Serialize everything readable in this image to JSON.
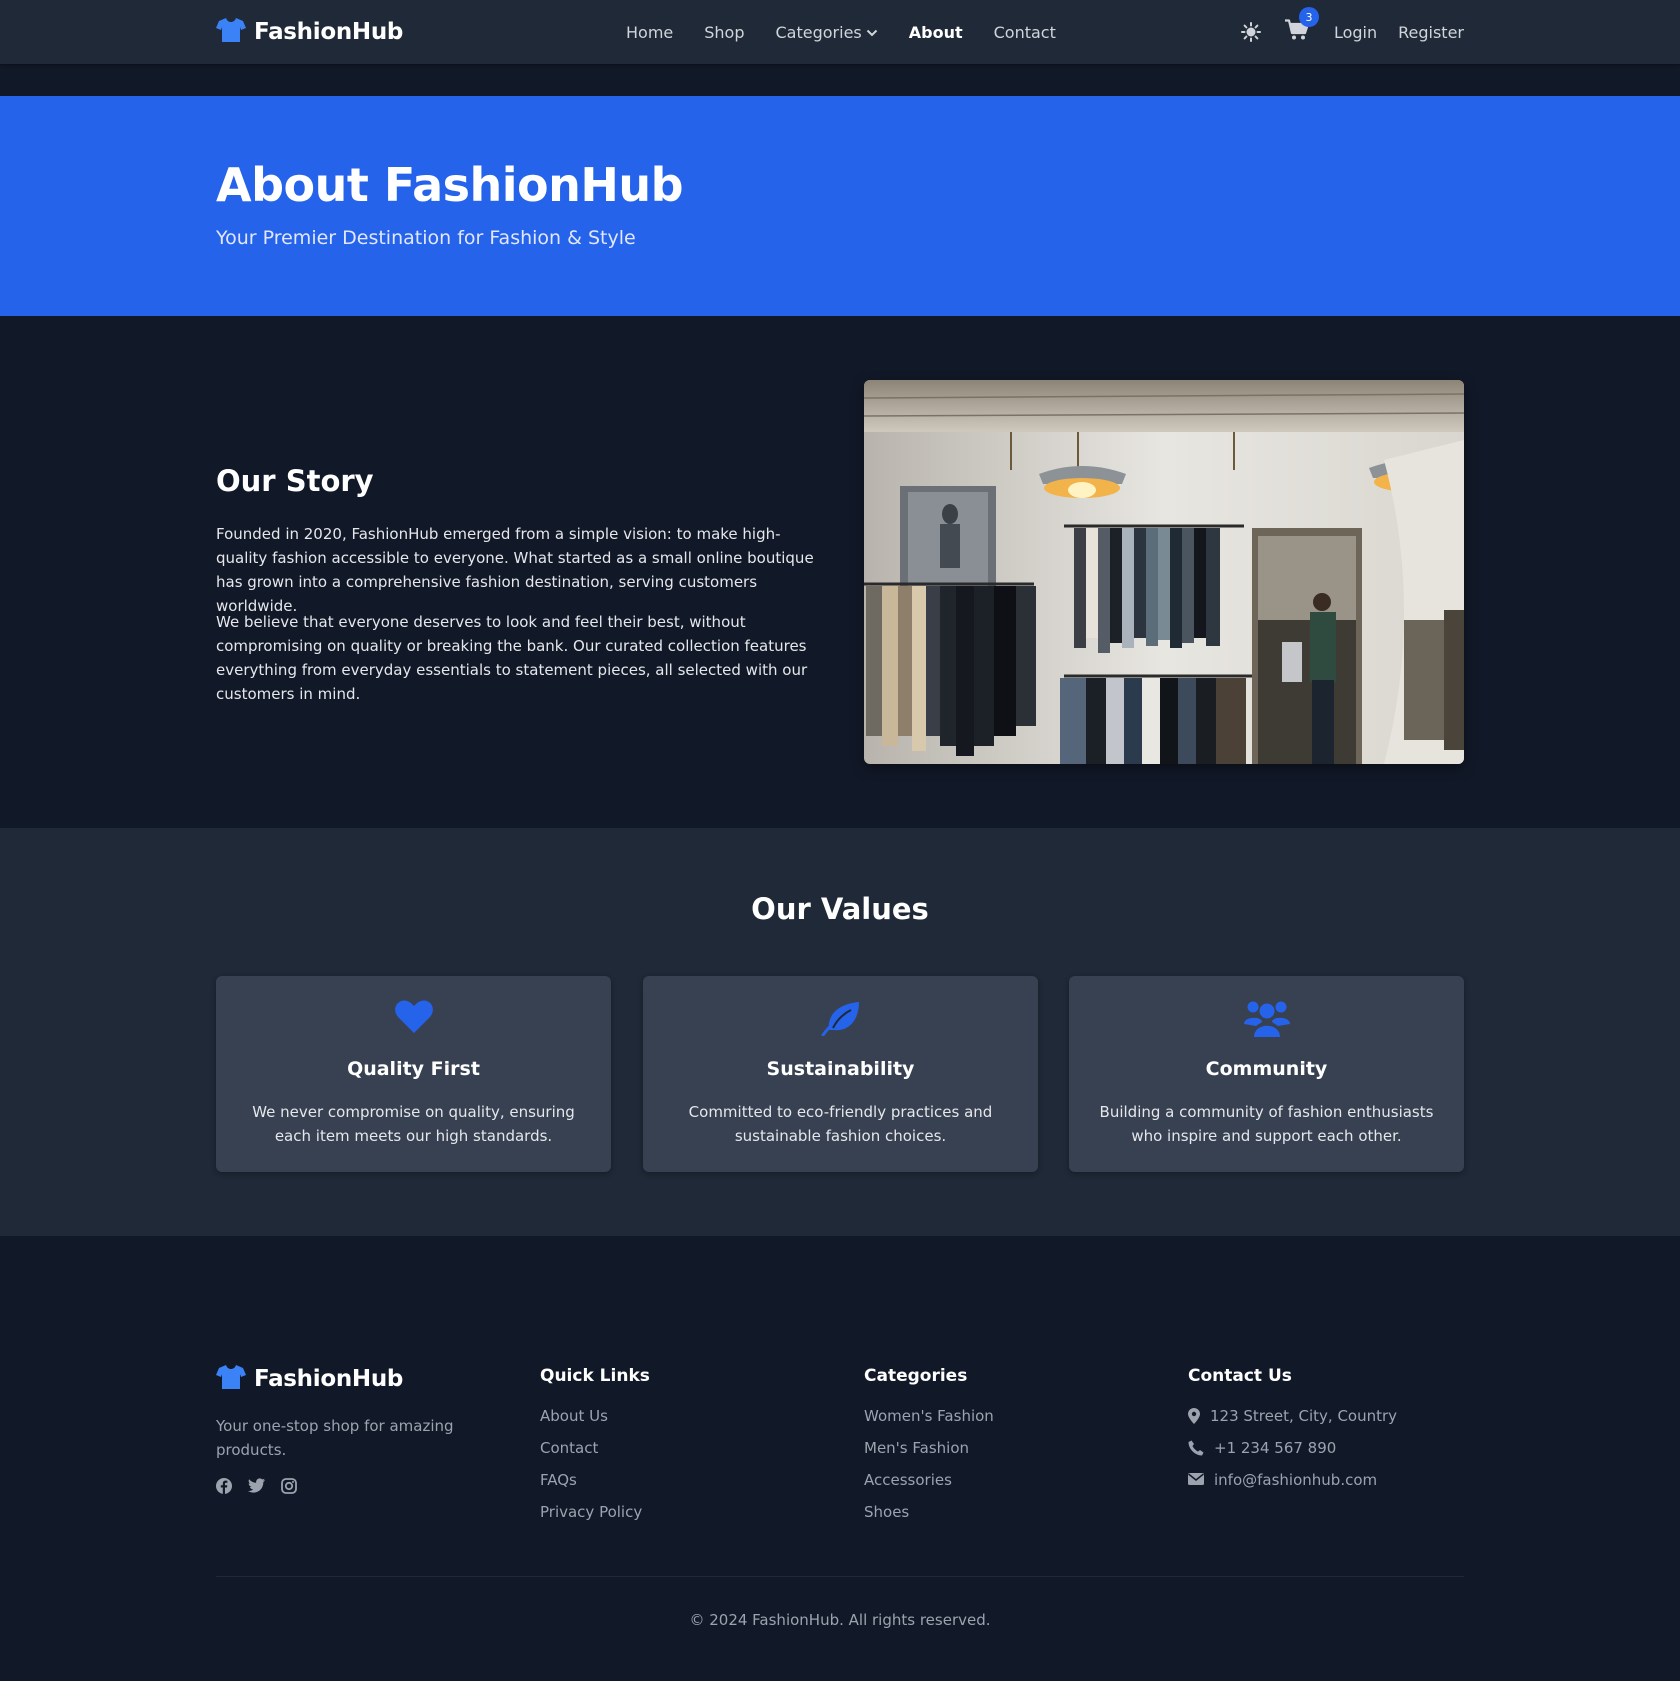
{
  "colors": {
    "accent": "#2563eb",
    "navbar_bg": "#1f2937",
    "page_bg": "#111827",
    "card_bg": "#374151"
  },
  "nav": {
    "brand": "FashionHub",
    "brand_icon": "tshirt-icon",
    "links": [
      "Home",
      "Shop",
      "Categories",
      "About",
      "Contact"
    ],
    "active": "About",
    "cart_count": "3",
    "login": "Login",
    "register": "Register"
  },
  "hero": {
    "title": "About FashionHub",
    "subtitle": "Your Premier Destination for Fashion & Style"
  },
  "story": {
    "title": "Our Story",
    "paragraphs": [
      "Founded in 2020, FashionHub emerged from a simple vision: to make high-quality fashion accessible to everyone. What started as a small online boutique has grown into a comprehensive fashion destination, serving customers worldwide.",
      "We believe that everyone deserves to look and feel their best, without compromising on quality or breaking the bank. Our curated collection features everything from everyday essentials to statement pieces, all selected with our customers in mind."
    ]
  },
  "values": {
    "title": "Our Values",
    "cards": [
      {
        "icon": "heart-icon",
        "title": "Quality First",
        "text": "We never compromise on quality, ensuring each item meets our high standards."
      },
      {
        "icon": "leaf-icon",
        "title": "Sustainability",
        "text": "Committed to eco-friendly practices and sustainable fashion choices."
      },
      {
        "icon": "users-icon",
        "title": "Community",
        "text": "Building a community of fashion enthusiasts who inspire and support each other."
      }
    ]
  },
  "footer": {
    "brand": "FashionHub",
    "tagline": "Your one-stop shop for amazing products.",
    "social": [
      "facebook-icon",
      "twitter-icon",
      "instagram-icon"
    ],
    "quick_links": {
      "title": "Quick Links",
      "items": [
        "About Us",
        "Contact",
        "FAQs",
        "Privacy Policy"
      ]
    },
    "categories": {
      "title": "Categories",
      "items": [
        "Women's Fashion",
        "Men's Fashion",
        "Accessories",
        "Shoes"
      ]
    },
    "contact": {
      "title": "Contact Us",
      "address": "123 Street, City, Country",
      "phone": "+1 234 567 890",
      "email": "info@fashionhub.com"
    },
    "copyright": "© 2024 FashionHub. All rights reserved."
  }
}
